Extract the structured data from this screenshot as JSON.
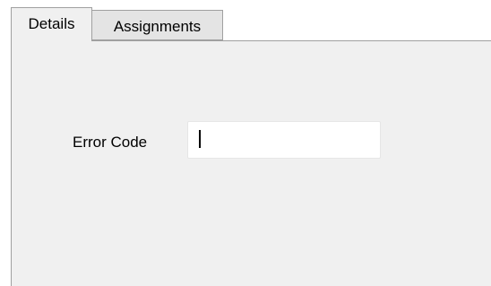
{
  "tabs": [
    {
      "label": "Details",
      "active": true
    },
    {
      "label": "Assignments",
      "active": false
    }
  ],
  "form": {
    "error_code": {
      "label": "Error Code",
      "value": "",
      "placeholder": ""
    }
  },
  "colors": {
    "panel_background": "#f0f0f0",
    "tab_border": "#a0a0a0",
    "inactive_tab_background": "#e4e4e4",
    "input_background": "#ffffff"
  }
}
